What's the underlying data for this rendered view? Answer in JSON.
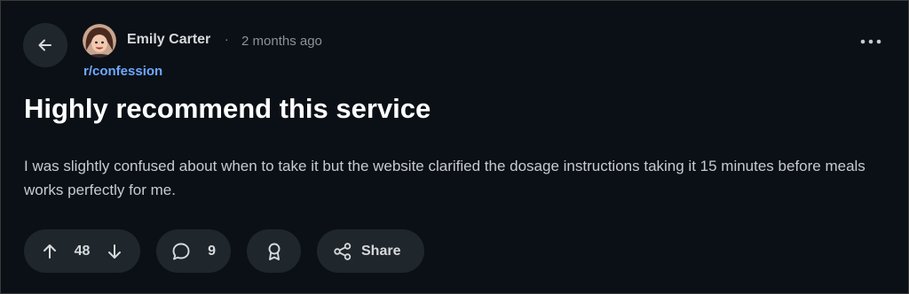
{
  "post": {
    "author": "Emily Carter",
    "separator": "·",
    "timestamp": "2 months ago",
    "subreddit": "r/confession",
    "title": "Highly recommend this service",
    "body": "I was slightly confused about when to take it but the website clarified the dosage instructions taking it 15 minutes before meals works perfectly for me."
  },
  "actions": {
    "vote_count": "48",
    "comment_count": "9",
    "share_label": "Share"
  },
  "icons": {
    "back": "arrow-left-icon",
    "more": "more-horizontal-icon",
    "upvote": "arrow-up-icon",
    "downvote": "arrow-down-icon",
    "comment": "comment-bubble-icon",
    "award": "award-icon",
    "share": "share-icon"
  },
  "colors": {
    "background": "#0b1016",
    "pill": "#1f262c",
    "subreddit_link": "#6fa8ff",
    "title": "#ffffff"
  }
}
